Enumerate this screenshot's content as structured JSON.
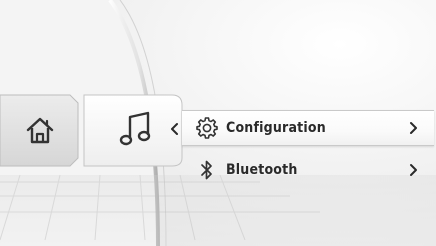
{
  "tabs": [
    {
      "name": "home",
      "icon": "home-icon",
      "active": false
    },
    {
      "name": "media",
      "icon": "music-note-icon",
      "active": true
    }
  ],
  "menu": {
    "items": [
      {
        "label": "Configuration",
        "icon": "gear-icon",
        "selected": true
      },
      {
        "label": "Bluetooth",
        "icon": "bluetooth-icon",
        "selected": false
      }
    ]
  },
  "colors": {
    "text": "#2a2a2a",
    "icon": "#333333",
    "selected_bg": "#ffffff",
    "background": "#e9e9e9"
  }
}
